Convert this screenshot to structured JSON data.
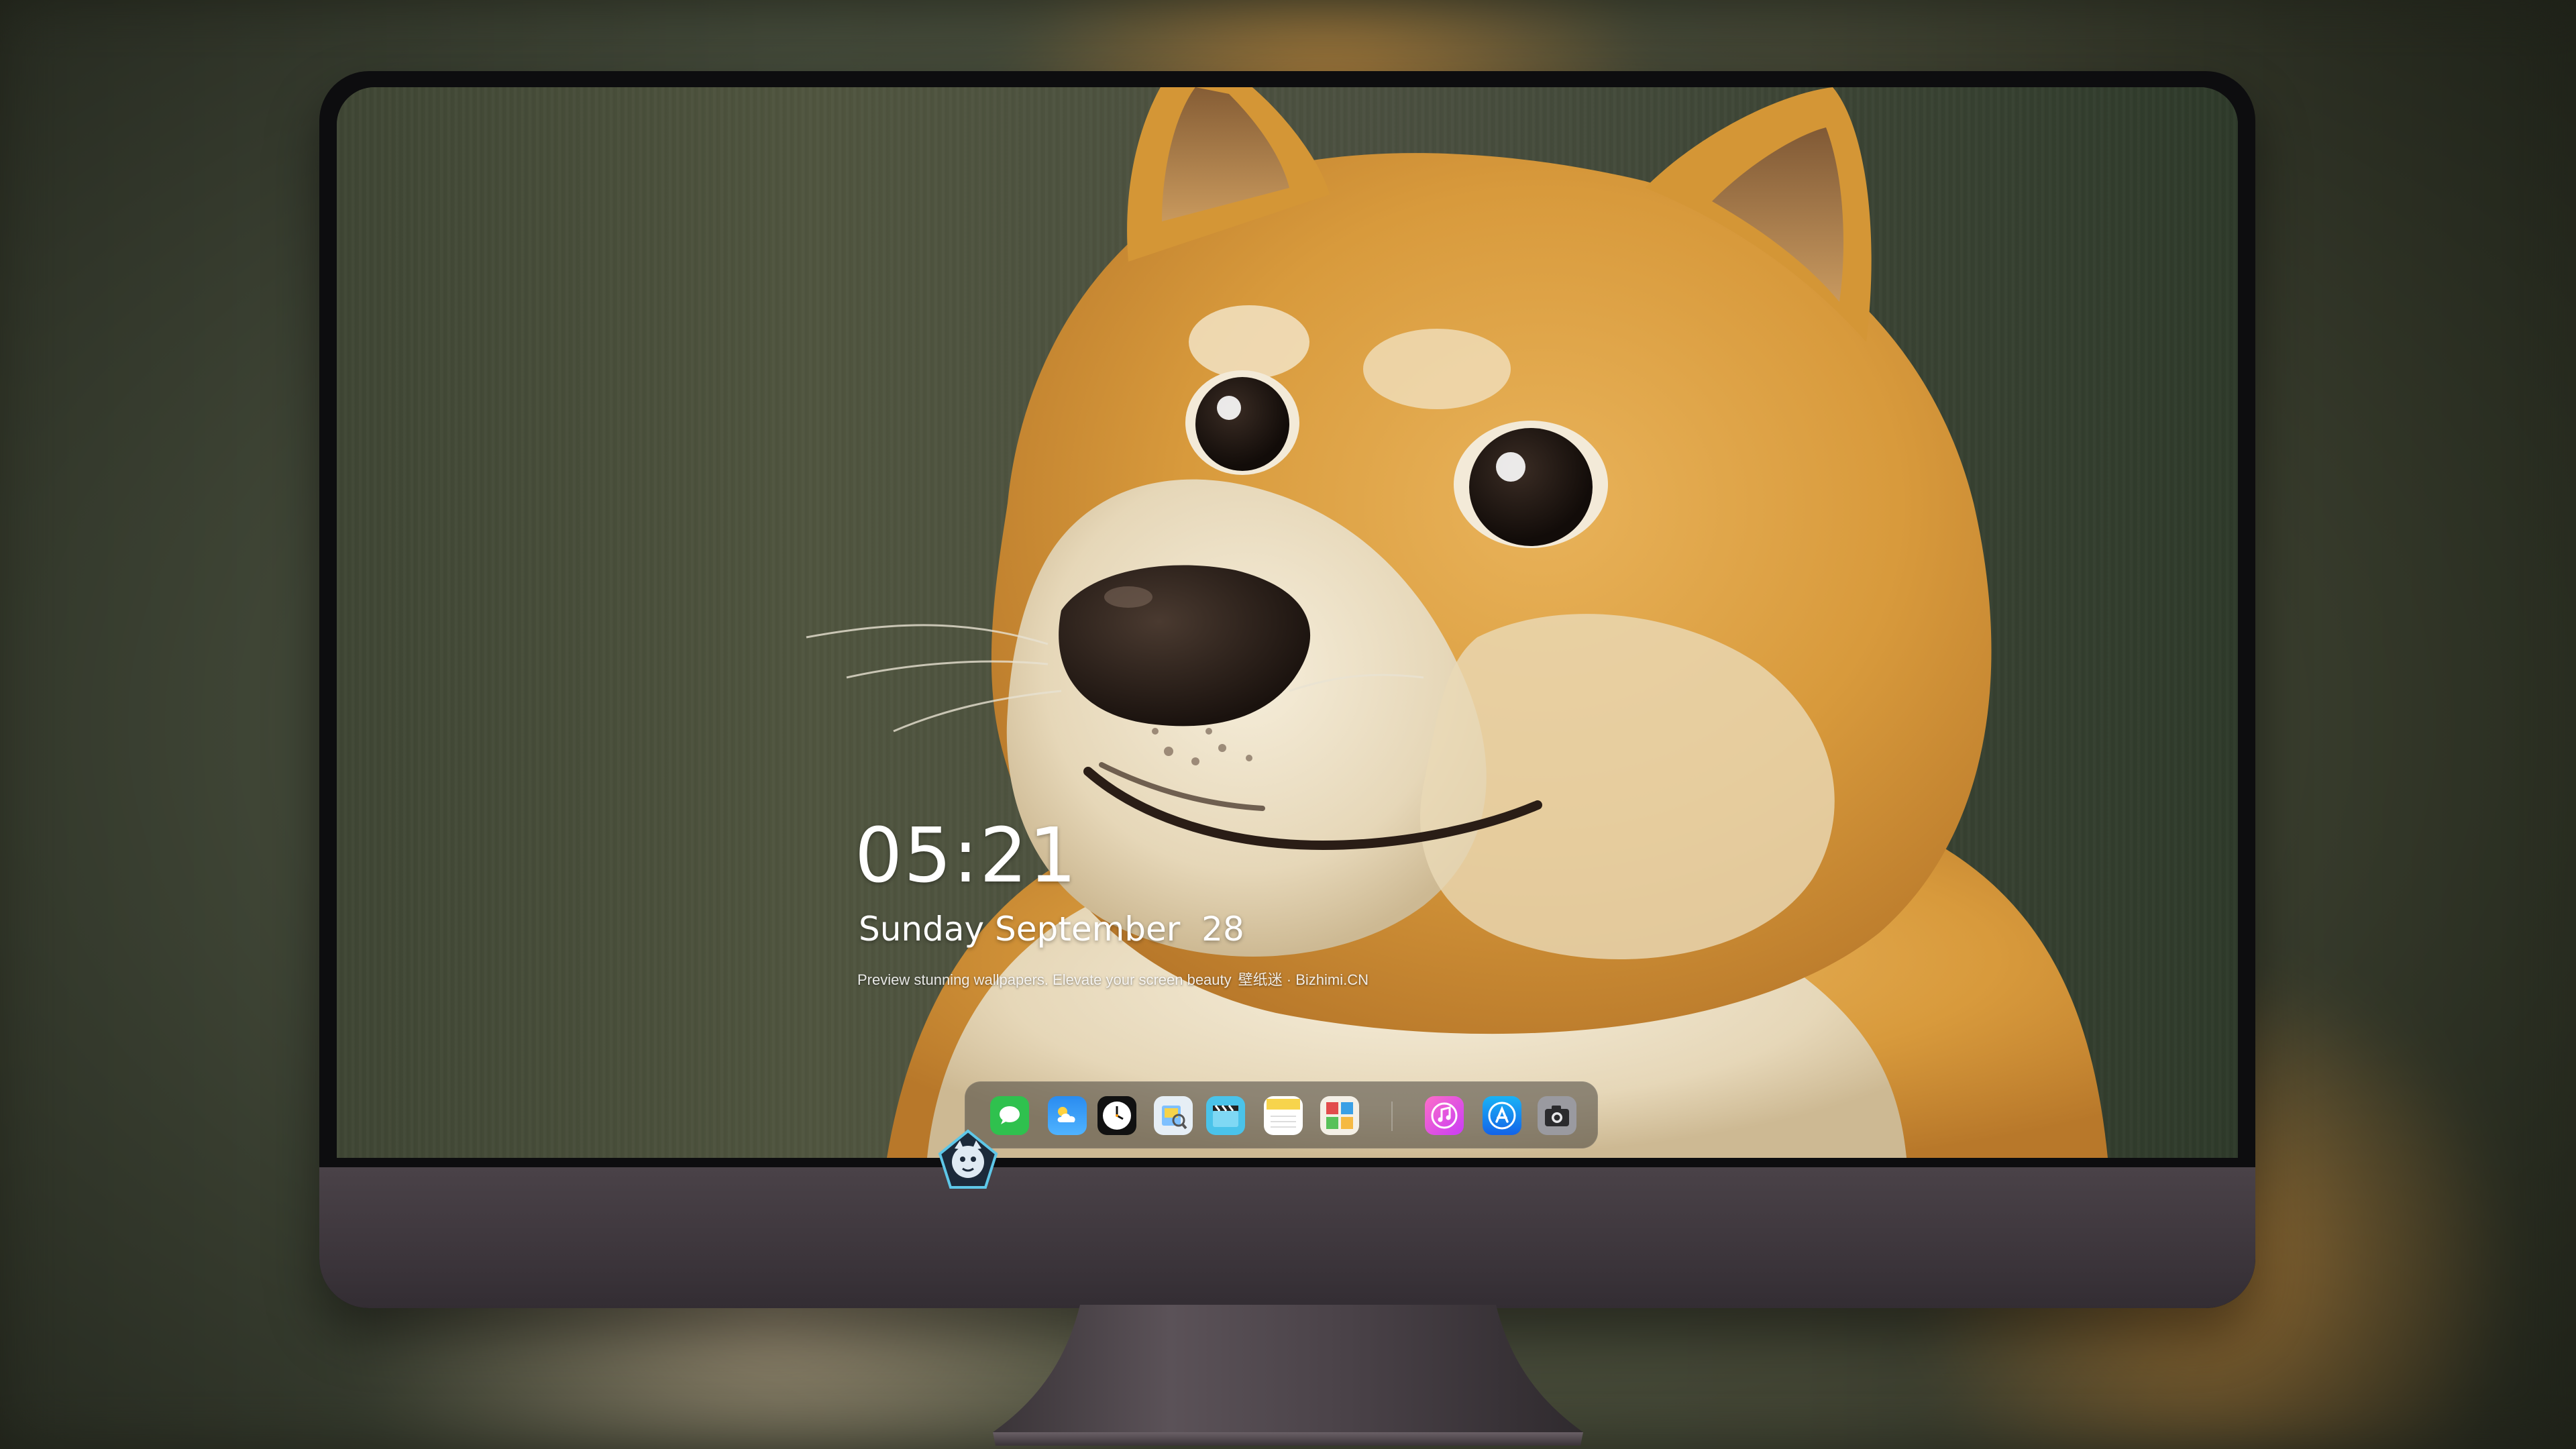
{
  "lockscreen": {
    "time": "05:21",
    "date": "Sunday September  28",
    "tagline": "Preview stunning wallpapers. Elevate your screen beauty",
    "brand": "壁纸迷 · Bizhimi.CN"
  },
  "dock": {
    "apps": [
      {
        "name": "messages-icon",
        "color": "#34c759"
      },
      {
        "name": "weather-icon",
        "color": "#1e90ff"
      },
      {
        "name": "clock-icon",
        "color": "#111111"
      },
      {
        "name": "preview-icon",
        "color": "#f5c542"
      },
      {
        "name": "clips-icon",
        "color": "#3fc0e8"
      },
      {
        "name": "notes-icon",
        "color": "#fde26a"
      },
      {
        "name": "photo-booth-icon",
        "color": "#e24c4c"
      },
      {
        "name": "music-icon",
        "color": "#fb5bc5"
      },
      {
        "name": "app-store-icon",
        "color": "#1b8cf5"
      },
      {
        "name": "screenshot-icon",
        "color": "#8e8e93"
      }
    ]
  },
  "colors": {
    "chin": "#3d363c",
    "screen_bezel": "#0d0d0f",
    "dog_orange": "#d99a3c",
    "dog_cream": "#efe4cd"
  }
}
